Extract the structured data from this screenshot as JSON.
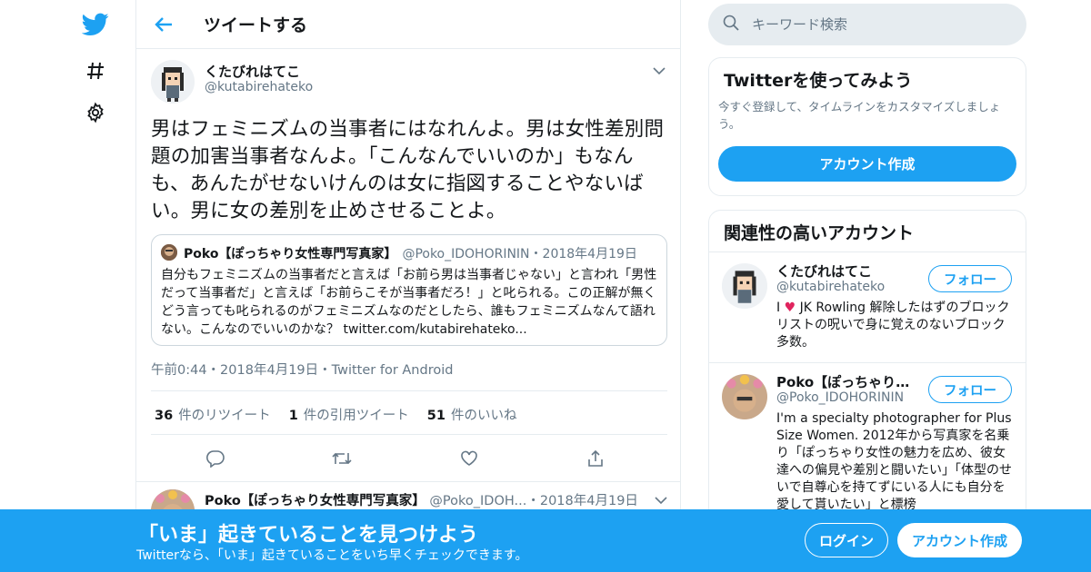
{
  "nav": {
    "icons": [
      "twitter-bird-icon",
      "hashtag-icon",
      "settings-gear-icon"
    ]
  },
  "header": {
    "title": "ツイートする"
  },
  "tweet": {
    "name": "くたびれはてこ",
    "handle": "@kutabirehateko",
    "text": "男はフェミニズムの当事者にはなれんよ。男は女性差別問題の加害当事者なんよ。「こんなんでいいのか」もなんも、あんたがせないけんのは女に指図することやないばい。男に女の差別を止めさせることよ。",
    "quote": {
      "name": "Poko【ぽっちゃり女性専門写真家】",
      "handle": "@Poko_IDOHORININ",
      "date": "・2018年4月19日",
      "text": "自分もフェミニズムの当事者だと言えば「お前ら男は当事者じゃない」と言われ「男性だって当事者だ」と言えば「お前らこそが当事者だろ！」と叱られる。この正解が無くどう言っても叱られるのがフェミニズムなのだとしたら、誰もフェミニズムなんて語れない。こんなのでいいのかな？ twitter.com/kutabirehateko..."
    },
    "meta": "午前0:44・2018年4月19日・Twitter for Android",
    "counts": {
      "retweets": "36",
      "retweets_label": "件のリツイート",
      "quotes": "1",
      "quotes_label": "件の引用ツイート",
      "likes": "51",
      "likes_label": "件のいいね"
    }
  },
  "reply": {
    "name": "Poko【ぽっちゃり女性専門写真家】",
    "handle": "@Poko_IDOH...",
    "date": "・2018年4月19日"
  },
  "search": {
    "placeholder": "キーワード検索"
  },
  "signup_card": {
    "title": "Twitterを使ってみよう",
    "subtitle": "今すぐ登録して、タイムラインをカスタマイズしましょう。",
    "button": "アカウント作成"
  },
  "related": {
    "title": "関連性の高いアカウント",
    "follow_label": "フォロー",
    "accounts": [
      {
        "name": "くたびれはてこ",
        "handle": "@kutabirehateko",
        "bio_prefix": "I",
        "bio_heart": "♥",
        "bio": " JK Rowling 解除したはずのブロックリストの呪いで身に覚えのないブロック多数。"
      },
      {
        "name": "Poko【ぽっちゃり女性専門写真家】",
        "handle": "@Poko_IDOHORININ",
        "bio": "I'm a specialty photographer for Plus Size Women. 2012年から写真家を名乗り「ぽっちゃり女性の魅力を広め、彼女達への偏見や差別と闘いたい」「体型のせいで自尊心を持てずにいる人にも自分を愛して貰いたい」と標榜"
      }
    ]
  },
  "banner": {
    "title": "「いま」起きていることを見つけよう",
    "subtitle": "Twitterなら、「いま」起きていることをいち早くチェックできます。",
    "login": "ログイン",
    "signup": "アカウント作成"
  },
  "colors": {
    "brand": "#1da1f2",
    "text": "#14171a",
    "secondary": "#657786",
    "border": "#e6ecf0",
    "heart": "#e0245e"
  }
}
